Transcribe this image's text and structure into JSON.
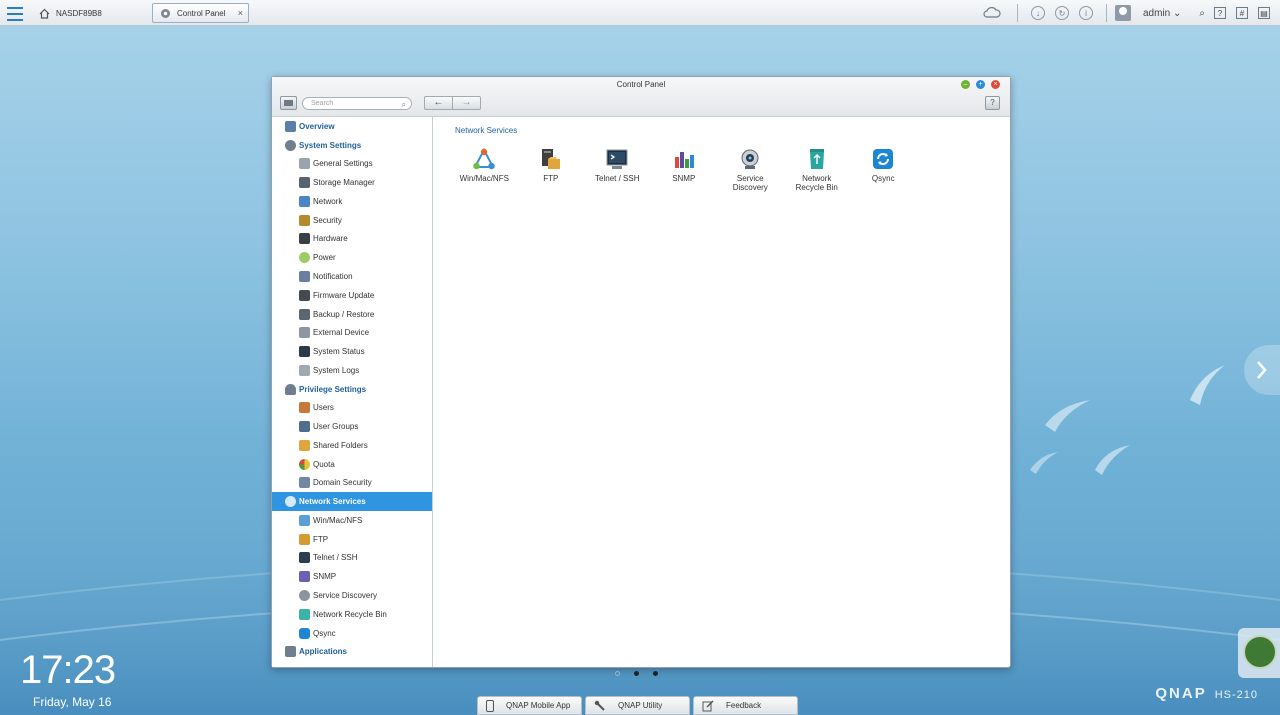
{
  "topbar": {
    "tabs": [
      {
        "label": "NASDF89B8"
      },
      {
        "label": "Control Panel",
        "close": "×"
      }
    ],
    "user": "admin"
  },
  "window": {
    "title": "Control Panel",
    "search_placeholder": "Search",
    "help": "?",
    "back": "←",
    "forward": "→"
  },
  "sidebar": {
    "overview": "Overview",
    "system_settings": "System Settings",
    "system_items": [
      "General Settings",
      "Storage Manager",
      "Network",
      "Security",
      "Hardware",
      "Power",
      "Notification",
      "Firmware Update",
      "Backup / Restore",
      "External Device",
      "System Status",
      "System Logs"
    ],
    "privilege_settings": "Privilege Settings",
    "privilege_items": [
      "Users",
      "User Groups",
      "Shared Folders",
      "Quota",
      "Domain Security"
    ],
    "network_services": "Network Services",
    "network_items": [
      "Win/Mac/NFS",
      "FTP",
      "Telnet / SSH",
      "SNMP",
      "Service Discovery",
      "Network Recycle Bin",
      "Qsync"
    ],
    "applications": "Applications"
  },
  "content": {
    "section_title": "Network Services",
    "apps": [
      {
        "line1": "Win/Mac/NFS",
        "line2": "",
        "icon": "shares-icon",
        "color": "#3b8fd8"
      },
      {
        "line1": "FTP",
        "line2": "",
        "icon": "ftp-icon",
        "color": "#4a4a4a"
      },
      {
        "line1": "Telnet / SSH",
        "line2": "",
        "icon": "terminal-icon",
        "color": "#24394f"
      },
      {
        "line1": "SNMP",
        "line2": "",
        "icon": "snmp-icon",
        "color": "#5a4ca3"
      },
      {
        "line1": "Service",
        "line2": "Discovery",
        "icon": "discovery-icon",
        "color": "#7f8a93"
      },
      {
        "line1": "Network",
        "line2": "Recycle Bin",
        "icon": "recycle-bin-icon",
        "color": "#2aa6a0"
      },
      {
        "line1": "Qsync",
        "line2": "",
        "icon": "qsync-icon",
        "color": "#1d86d3"
      }
    ]
  },
  "desktop": {
    "time": "17:23",
    "date": "Friday, May 16",
    "brand": "QNAP",
    "model": "HS-210",
    "dock": [
      "QNAP Mobile App",
      "QNAP Utility",
      "Feedback"
    ]
  }
}
